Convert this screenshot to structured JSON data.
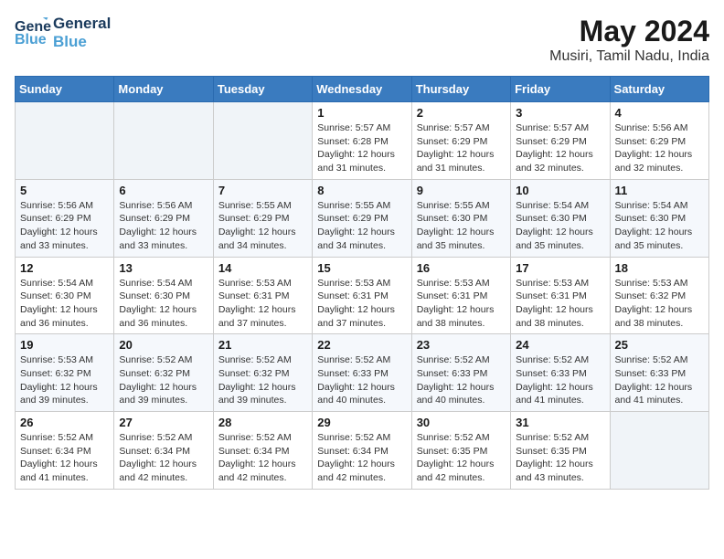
{
  "header": {
    "logo_line1": "General",
    "logo_line2": "Blue",
    "month_year": "May 2024",
    "location": "Musiri, Tamil Nadu, India"
  },
  "weekdays": [
    "Sunday",
    "Monday",
    "Tuesday",
    "Wednesday",
    "Thursday",
    "Friday",
    "Saturday"
  ],
  "weeks": [
    [
      {
        "day": "",
        "info": ""
      },
      {
        "day": "",
        "info": ""
      },
      {
        "day": "",
        "info": ""
      },
      {
        "day": "1",
        "info": "Sunrise: 5:57 AM\nSunset: 6:28 PM\nDaylight: 12 hours\nand 31 minutes."
      },
      {
        "day": "2",
        "info": "Sunrise: 5:57 AM\nSunset: 6:29 PM\nDaylight: 12 hours\nand 31 minutes."
      },
      {
        "day": "3",
        "info": "Sunrise: 5:57 AM\nSunset: 6:29 PM\nDaylight: 12 hours\nand 32 minutes."
      },
      {
        "day": "4",
        "info": "Sunrise: 5:56 AM\nSunset: 6:29 PM\nDaylight: 12 hours\nand 32 minutes."
      }
    ],
    [
      {
        "day": "5",
        "info": "Sunrise: 5:56 AM\nSunset: 6:29 PM\nDaylight: 12 hours\nand 33 minutes."
      },
      {
        "day": "6",
        "info": "Sunrise: 5:56 AM\nSunset: 6:29 PM\nDaylight: 12 hours\nand 33 minutes."
      },
      {
        "day": "7",
        "info": "Sunrise: 5:55 AM\nSunset: 6:29 PM\nDaylight: 12 hours\nand 34 minutes."
      },
      {
        "day": "8",
        "info": "Sunrise: 5:55 AM\nSunset: 6:29 PM\nDaylight: 12 hours\nand 34 minutes."
      },
      {
        "day": "9",
        "info": "Sunrise: 5:55 AM\nSunset: 6:30 PM\nDaylight: 12 hours\nand 35 minutes."
      },
      {
        "day": "10",
        "info": "Sunrise: 5:54 AM\nSunset: 6:30 PM\nDaylight: 12 hours\nand 35 minutes."
      },
      {
        "day": "11",
        "info": "Sunrise: 5:54 AM\nSunset: 6:30 PM\nDaylight: 12 hours\nand 35 minutes."
      }
    ],
    [
      {
        "day": "12",
        "info": "Sunrise: 5:54 AM\nSunset: 6:30 PM\nDaylight: 12 hours\nand 36 minutes."
      },
      {
        "day": "13",
        "info": "Sunrise: 5:54 AM\nSunset: 6:30 PM\nDaylight: 12 hours\nand 36 minutes."
      },
      {
        "day": "14",
        "info": "Sunrise: 5:53 AM\nSunset: 6:31 PM\nDaylight: 12 hours\nand 37 minutes."
      },
      {
        "day": "15",
        "info": "Sunrise: 5:53 AM\nSunset: 6:31 PM\nDaylight: 12 hours\nand 37 minutes."
      },
      {
        "day": "16",
        "info": "Sunrise: 5:53 AM\nSunset: 6:31 PM\nDaylight: 12 hours\nand 38 minutes."
      },
      {
        "day": "17",
        "info": "Sunrise: 5:53 AM\nSunset: 6:31 PM\nDaylight: 12 hours\nand 38 minutes."
      },
      {
        "day": "18",
        "info": "Sunrise: 5:53 AM\nSunset: 6:32 PM\nDaylight: 12 hours\nand 38 minutes."
      }
    ],
    [
      {
        "day": "19",
        "info": "Sunrise: 5:53 AM\nSunset: 6:32 PM\nDaylight: 12 hours\nand 39 minutes."
      },
      {
        "day": "20",
        "info": "Sunrise: 5:52 AM\nSunset: 6:32 PM\nDaylight: 12 hours\nand 39 minutes."
      },
      {
        "day": "21",
        "info": "Sunrise: 5:52 AM\nSunset: 6:32 PM\nDaylight: 12 hours\nand 39 minutes."
      },
      {
        "day": "22",
        "info": "Sunrise: 5:52 AM\nSunset: 6:33 PM\nDaylight: 12 hours\nand 40 minutes."
      },
      {
        "day": "23",
        "info": "Sunrise: 5:52 AM\nSunset: 6:33 PM\nDaylight: 12 hours\nand 40 minutes."
      },
      {
        "day": "24",
        "info": "Sunrise: 5:52 AM\nSunset: 6:33 PM\nDaylight: 12 hours\nand 41 minutes."
      },
      {
        "day": "25",
        "info": "Sunrise: 5:52 AM\nSunset: 6:33 PM\nDaylight: 12 hours\nand 41 minutes."
      }
    ],
    [
      {
        "day": "26",
        "info": "Sunrise: 5:52 AM\nSunset: 6:34 PM\nDaylight: 12 hours\nand 41 minutes."
      },
      {
        "day": "27",
        "info": "Sunrise: 5:52 AM\nSunset: 6:34 PM\nDaylight: 12 hours\nand 42 minutes."
      },
      {
        "day": "28",
        "info": "Sunrise: 5:52 AM\nSunset: 6:34 PM\nDaylight: 12 hours\nand 42 minutes."
      },
      {
        "day": "29",
        "info": "Sunrise: 5:52 AM\nSunset: 6:34 PM\nDaylight: 12 hours\nand 42 minutes."
      },
      {
        "day": "30",
        "info": "Sunrise: 5:52 AM\nSunset: 6:35 PM\nDaylight: 12 hours\nand 42 minutes."
      },
      {
        "day": "31",
        "info": "Sunrise: 5:52 AM\nSunset: 6:35 PM\nDaylight: 12 hours\nand 43 minutes."
      },
      {
        "day": "",
        "info": ""
      }
    ]
  ]
}
